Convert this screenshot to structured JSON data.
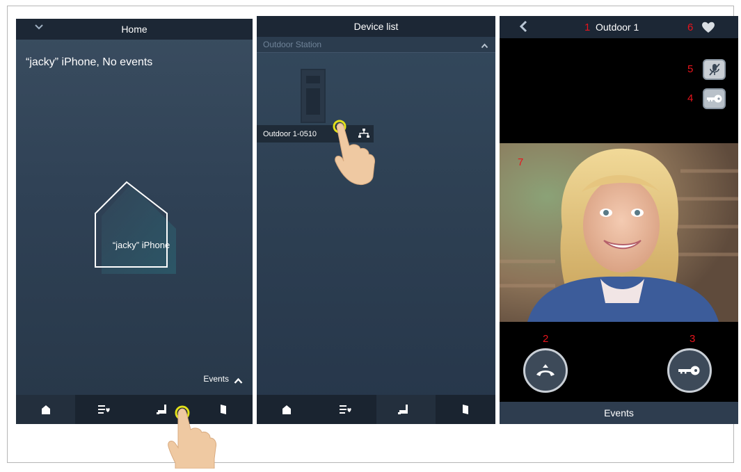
{
  "home": {
    "title": "Home",
    "status": "“jacky” iPhone, No events",
    "house_label": "“jacky” iPhone",
    "events_label": "Events"
  },
  "device_list": {
    "title": "Device list",
    "section": "Outdoor Station",
    "device_name": "Outdoor 1-0510"
  },
  "call": {
    "title": "Outdoor 1",
    "callouts": [
      "1",
      "2",
      "3",
      "4",
      "5",
      "6",
      "7"
    ],
    "events_label": "Events"
  },
  "colors": {
    "callout": "#e8141c",
    "highlight": "#e2e01a",
    "bar": "#1c2735"
  }
}
